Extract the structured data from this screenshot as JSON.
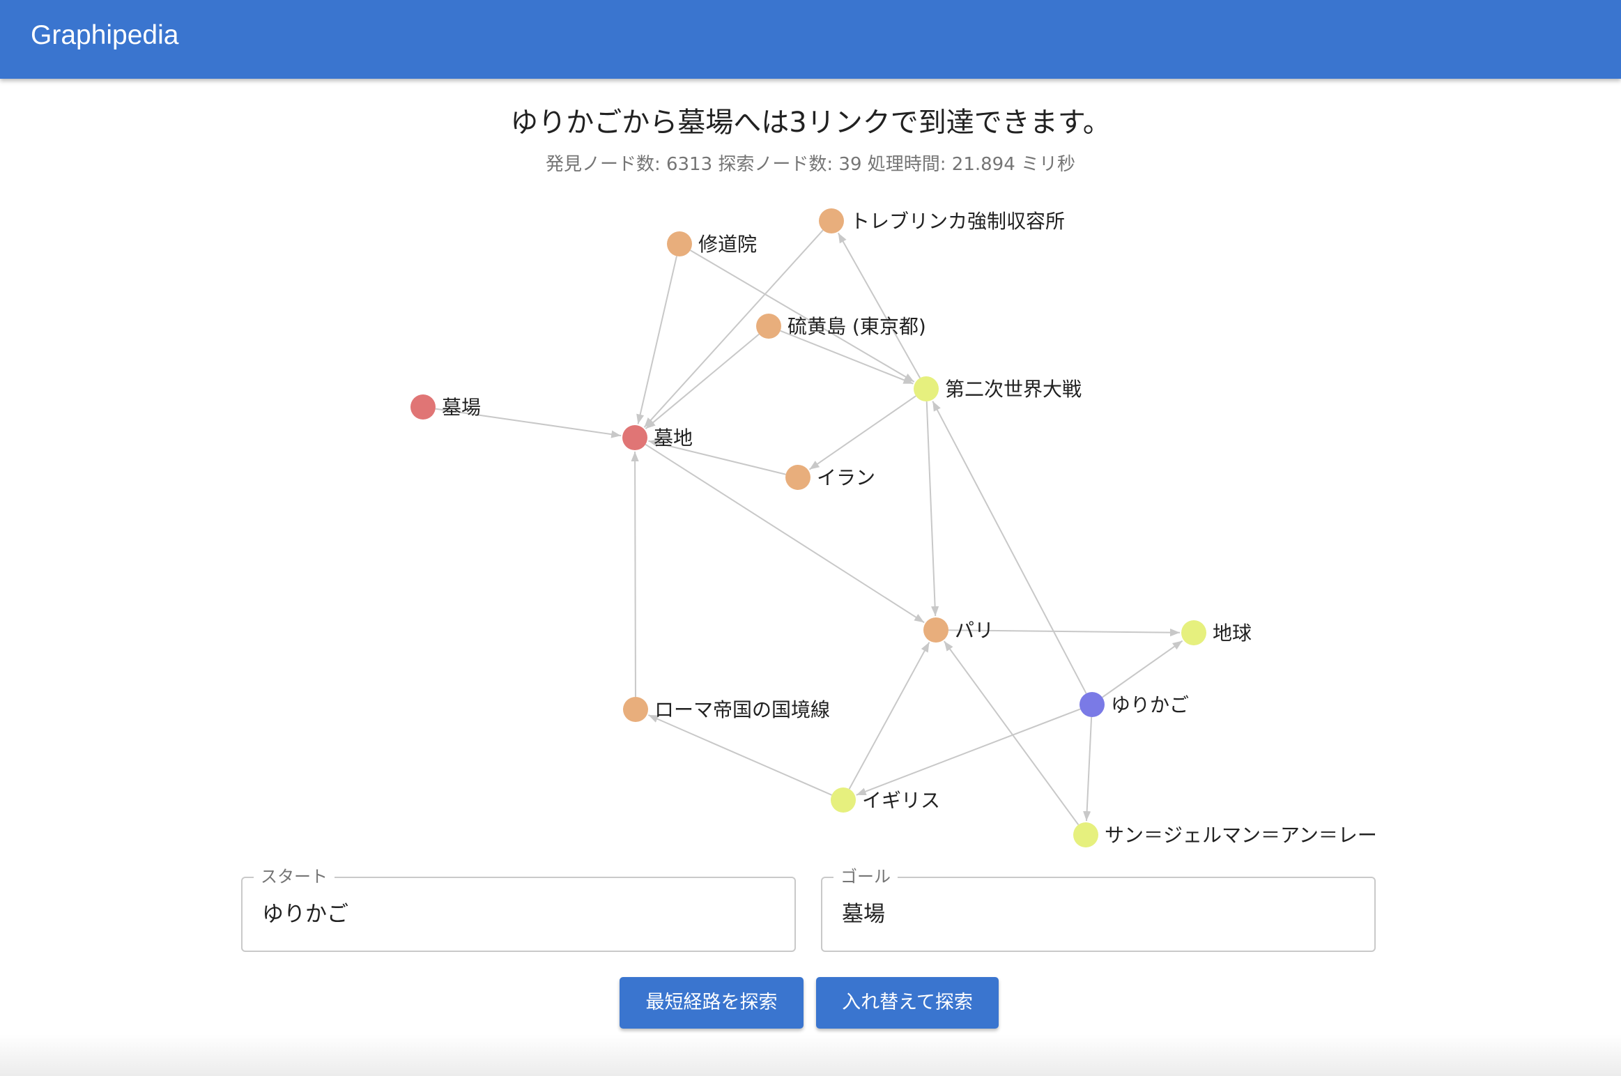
{
  "app": {
    "title": "Graphipedia"
  },
  "result": {
    "headline": "ゆりかごから墓場へは3リンクで到達できます。",
    "stats": "発見ノード数: 6313 探索ノード数: 39 処理時間: 21.894 ミリ秒"
  },
  "graph": {
    "colors": {
      "endpoint_goal": "#e07575",
      "start": "#7a7ae6",
      "near_start": "#e6f07e",
      "intermediate": "#e8ae7c",
      "edge": "#c8c8c8"
    },
    "nodes": [
      {
        "id": "bochi",
        "label": "墓地",
        "kind": "endpoint_goal"
      },
      {
        "id": "hakaba",
        "label": "墓場",
        "kind": "endpoint_goal"
      },
      {
        "id": "shudoin",
        "label": "修道院",
        "kind": "intermediate"
      },
      {
        "id": "treblinka",
        "label": "トレブリンカ強制収容所",
        "kind": "intermediate"
      },
      {
        "id": "iwoto",
        "label": "硫黄島 (東京都)",
        "kind": "intermediate"
      },
      {
        "id": "ww2",
        "label": "第二次世界大戦",
        "kind": "near_start"
      },
      {
        "id": "iran",
        "label": "イラン",
        "kind": "intermediate"
      },
      {
        "id": "paris",
        "label": "パリ",
        "kind": "intermediate"
      },
      {
        "id": "chikyu",
        "label": "地球",
        "kind": "near_start"
      },
      {
        "id": "yurikago",
        "label": "ゆりかご",
        "kind": "start"
      },
      {
        "id": "limes",
        "label": "ローマ帝国の国境線",
        "kind": "intermediate"
      },
      {
        "id": "uk",
        "label": "イギリス",
        "kind": "near_start"
      },
      {
        "id": "sgl",
        "label": "サン＝ジェルマン＝アン＝レー",
        "kind": "near_start"
      }
    ],
    "edges": [
      [
        "hakaba",
        "bochi"
      ],
      [
        "shudoin",
        "bochi"
      ],
      [
        "shudoin",
        "ww2"
      ],
      [
        "treblinka",
        "bochi"
      ],
      [
        "ww2",
        "treblinka"
      ],
      [
        "iwoto",
        "bochi"
      ],
      [
        "iwoto",
        "ww2"
      ],
      [
        "ww2",
        "iran"
      ],
      [
        "iran",
        "bochi"
      ],
      [
        "ww2",
        "paris"
      ],
      [
        "bochi",
        "paris"
      ],
      [
        "limes",
        "bochi"
      ],
      [
        "paris",
        "chikyu"
      ],
      [
        "yurikago",
        "chikyu"
      ],
      [
        "yurikago",
        "ww2"
      ],
      [
        "yurikago",
        "uk"
      ],
      [
        "yurikago",
        "sgl"
      ],
      [
        "uk",
        "paris"
      ],
      [
        "uk",
        "limes"
      ],
      [
        "sgl",
        "paris"
      ]
    ]
  },
  "form": {
    "start": {
      "label": "スタート",
      "value": "ゆりかご"
    },
    "goal": {
      "label": "ゴール",
      "value": "墓場"
    },
    "search_button": "最短経路を探索",
    "swap_button": "入れ替えて探索"
  }
}
